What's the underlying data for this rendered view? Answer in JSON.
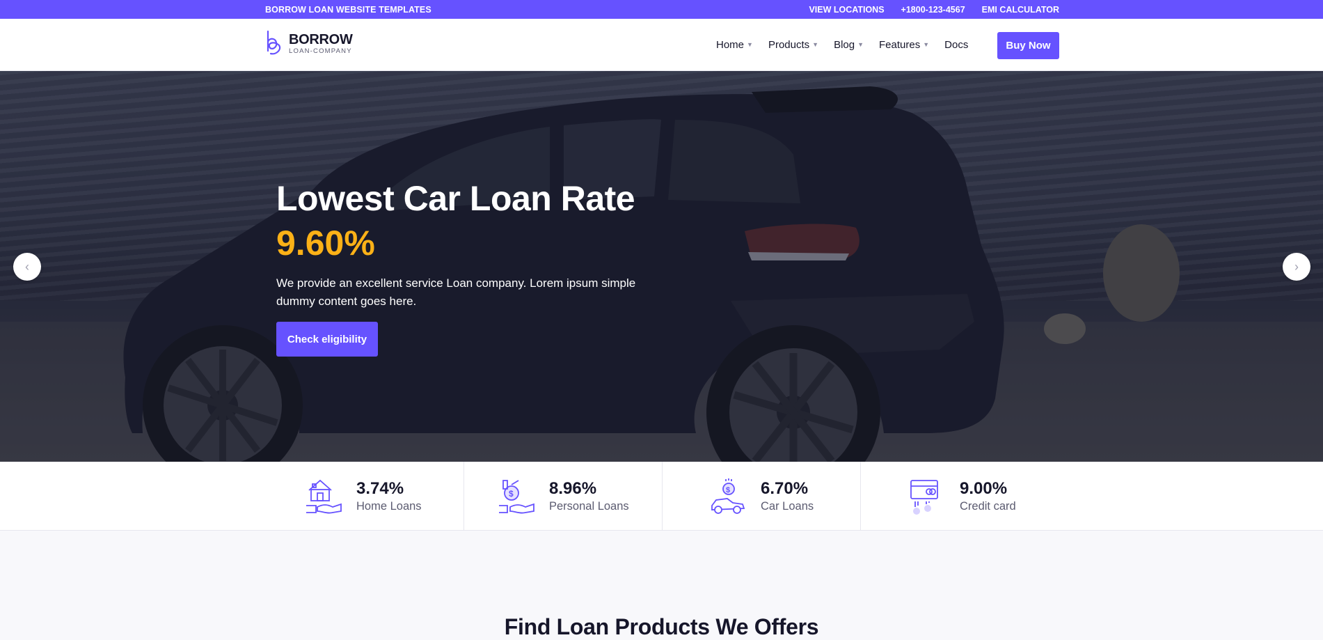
{
  "topbar": {
    "tagline": "BORROW LOAN WEBSITE TEMPLATES",
    "links": [
      "VIEW LOCATIONS",
      "+1800-123-4567",
      "EMI CALCULATOR"
    ]
  },
  "brand": {
    "name": "BORROW",
    "subtitle": "LOAN-COMPANY",
    "accent": "#6652ff"
  },
  "nav": {
    "items": [
      {
        "label": "Home",
        "dropdown": true
      },
      {
        "label": "Products",
        "dropdown": true
      },
      {
        "label": "Blog",
        "dropdown": true
      },
      {
        "label": "Features",
        "dropdown": true
      },
      {
        "label": "Docs",
        "dropdown": false
      }
    ],
    "cta": "Buy Now"
  },
  "hero": {
    "title": "Lowest Car Loan Rate",
    "rate": "9.60%",
    "description": "We provide an excellent service Loan company. Lorem ipsum simple dummy content goes here.",
    "button": "Check eligibility",
    "rate_color": "#fbb117",
    "prev_icon": "chevron-left-icon",
    "next_icon": "chevron-right-icon"
  },
  "rates": [
    {
      "value": "3.74%",
      "label": "Home Loans",
      "icon": "house-hand-icon"
    },
    {
      "value": "8.96%",
      "label": "Personal Loans",
      "icon": "money-hand-icon"
    },
    {
      "value": "6.70%",
      "label": "Car Loans",
      "icon": "car-money-icon"
    },
    {
      "value": "9.00%",
      "label": "Credit card",
      "icon": "credit-card-icon"
    }
  ],
  "section": {
    "title": "Find Loan Products We Offers"
  }
}
